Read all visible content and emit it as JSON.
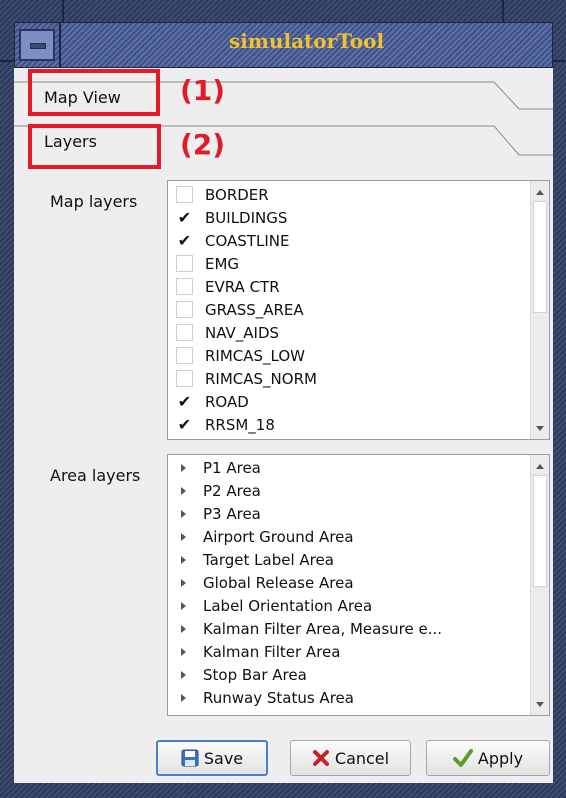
{
  "window": {
    "title": "simulatorTool"
  },
  "sections": {
    "map_view": {
      "label": "Map View"
    },
    "layers": {
      "label": "Layers"
    }
  },
  "annotations": [
    "(1)",
    "(2)"
  ],
  "map_layers": {
    "label": "Map layers",
    "items": [
      {
        "name": "BORDER",
        "checked": false
      },
      {
        "name": "BUILDINGS",
        "checked": true
      },
      {
        "name": "COASTLINE",
        "checked": true
      },
      {
        "name": "EMG",
        "checked": false
      },
      {
        "name": "EVRA CTR",
        "checked": false
      },
      {
        "name": "GRASS_AREA",
        "checked": false
      },
      {
        "name": "NAV_AIDS",
        "checked": false
      },
      {
        "name": "RIMCAS_LOW",
        "checked": false
      },
      {
        "name": "RIMCAS_NORM",
        "checked": false
      },
      {
        "name": "ROAD",
        "checked": true
      },
      {
        "name": "RRSM_18",
        "checked": true
      }
    ]
  },
  "area_layers": {
    "label": "Area layers",
    "items": [
      "P1 Area",
      "P2 Area",
      "P3 Area",
      "Airport Ground Area",
      "Target Label Area",
      "Global Release Area",
      "Label Orientation Area",
      "Kalman Filter Area, Measure e...",
      "Kalman Filter Area",
      "Stop Bar Area",
      "Runway Status Area"
    ]
  },
  "buttons": {
    "save": "Save",
    "cancel": "Cancel",
    "apply": "Apply"
  },
  "icons": {
    "save": "floppy-disk-icon",
    "cancel": "red-x-icon",
    "apply": "green-check-icon"
  },
  "colors": {
    "annotation": "#e21a2a",
    "title_text": "#f2c22e",
    "focus": "#4a7fc9"
  }
}
